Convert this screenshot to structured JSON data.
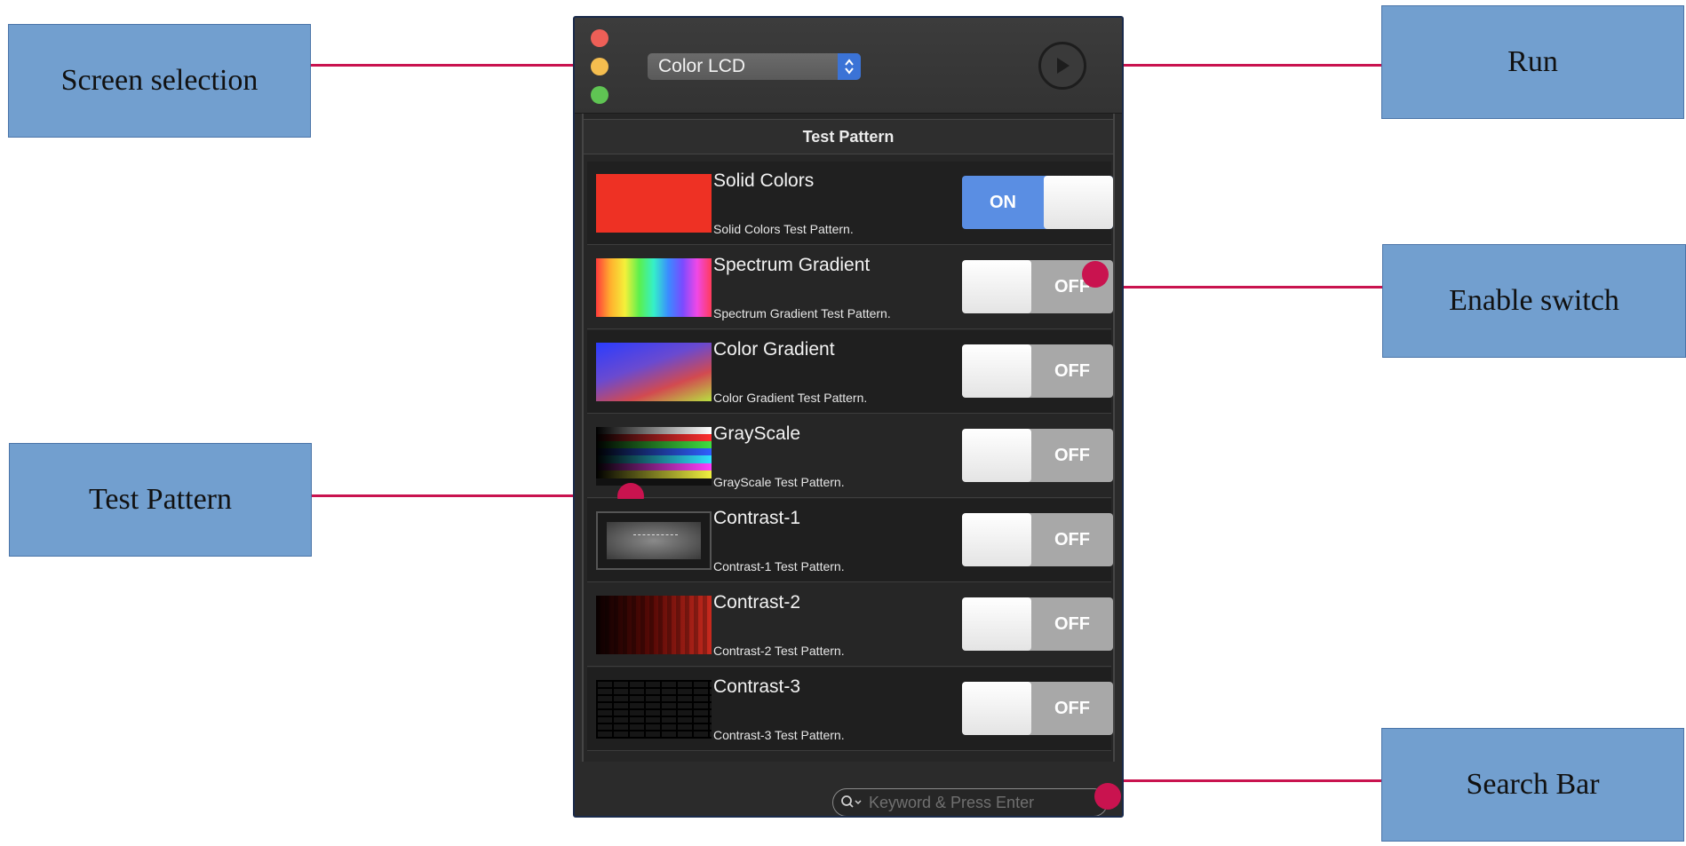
{
  "callouts": {
    "screen_selection": "Screen selection",
    "run": "Run",
    "enable_switch": "Enable switch",
    "test_pattern": "Test Pattern",
    "search_bar": "Search Bar"
  },
  "toolbar": {
    "screen_select_value": "Color LCD"
  },
  "list": {
    "header": "Test Pattern",
    "items": [
      {
        "title": "Solid Colors",
        "description": "Solid Colors Test Pattern.",
        "switch": "ON",
        "enabled": true
      },
      {
        "title": "Spectrum Gradient",
        "description": "Spectrum Gradient Test Pattern.",
        "switch": "OFF",
        "enabled": false
      },
      {
        "title": "Color Gradient",
        "description": "Color Gradient Test Pattern.",
        "switch": "OFF",
        "enabled": false
      },
      {
        "title": "GrayScale",
        "description": "GrayScale Test Pattern.",
        "switch": "OFF",
        "enabled": false
      },
      {
        "title": "Contrast-1",
        "description": "Contrast-1 Test Pattern.",
        "switch": "OFF",
        "enabled": false
      },
      {
        "title": "Contrast-2",
        "description": "Contrast-2 Test Pattern.",
        "switch": "OFF",
        "enabled": false
      },
      {
        "title": "Contrast-3",
        "description": "Contrast-3 Test Pattern.",
        "switch": "OFF",
        "enabled": false
      }
    ]
  },
  "search": {
    "placeholder": "Keyword & Press Enter"
  },
  "colors": {
    "callout_fill": "#729fcf",
    "leader": "#c9134f",
    "switch_on": "#5a8ee3",
    "switch_off": "#a8a8a8"
  },
  "icons": {
    "run": "play-circle-icon",
    "search": "magnifier-dropdown-icon",
    "select": "up-down-chevron-icon"
  }
}
